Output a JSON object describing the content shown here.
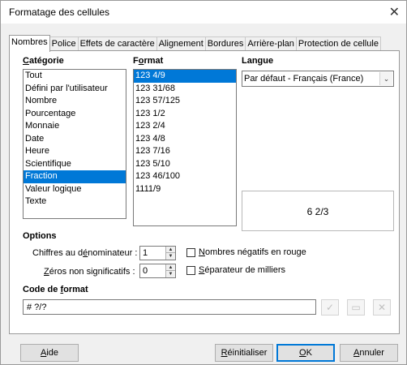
{
  "window": {
    "title": "Formatage des cellules"
  },
  "tabs": [
    {
      "label": "Nombres",
      "active": true
    },
    {
      "label": "Police"
    },
    {
      "label": "Effets de caractère"
    },
    {
      "label": "Alignement"
    },
    {
      "label": "Bordures"
    },
    {
      "label": "Arrière-plan"
    },
    {
      "label": "Protection de cellule"
    }
  ],
  "category": {
    "header": "Catégorie",
    "items": [
      "Tout",
      "Défini par l'utilisateur",
      "Nombre",
      "Pourcentage",
      "Monnaie",
      "Date",
      "Heure",
      "Scientifique",
      "Fraction",
      "Valeur logique",
      "Texte"
    ],
    "selected_index": 8
  },
  "format": {
    "header": "Format",
    "items": [
      "123 4/9",
      "123 31/68",
      "123  57/125",
      "123 1/2",
      "123 2/4",
      "123 4/8",
      "123  7/16",
      "123  5/10",
      "123 46/100",
      "1111/9"
    ],
    "selected_index": 0
  },
  "language": {
    "header": "Langue",
    "value": "Par défaut - Français (France)"
  },
  "preview": {
    "text": "6 2/3"
  },
  "options": {
    "header": "Options",
    "denominator_label": "Chiffres au dénominateur :",
    "denominator_value": "1",
    "zeros_label": "Zéros non significatifs :",
    "zeros_value": "0",
    "negative_red_label": "Nombres négatifs en rouge",
    "negative_red_checked": false,
    "thousands_sep_label": "Séparateur de milliers",
    "thousands_sep_checked": false
  },
  "format_code": {
    "header": "Code de format",
    "value": "# ?/?"
  },
  "buttons": {
    "help": "Aide",
    "reset": "Réinitialiser",
    "ok": "OK",
    "cancel": "Annuler"
  },
  "colors": {
    "selection": "#0078d7"
  }
}
